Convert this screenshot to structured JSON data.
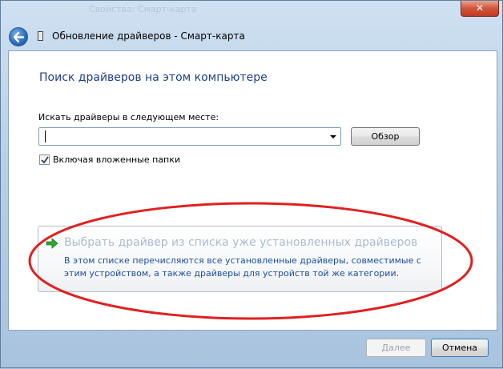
{
  "window": {
    "title": "Обновление драйверов - Смарт-карта",
    "close_label": "✕",
    "ghost_titles": "Свойства: Смарт-карта"
  },
  "page": {
    "heading": "Поиск драйверов на этом компьютере",
    "search_label": "Искать драйверы в следующем месте:",
    "path_value": "",
    "browse_label": "Обзор",
    "include_subfolders_label": "Включая вложенные папки",
    "include_subfolders_checked": true
  },
  "command_link": {
    "title": "Выбрать драйвер из списка уже установленных драйверов",
    "description": "В этом списке перечисляются все установленные драйверы, совместимые с этим устройством, а также драйверы для устройств той же категории."
  },
  "footer": {
    "next_label": "Далее",
    "cancel_label": "Отмена"
  },
  "colors": {
    "heading": "#1e3f8a",
    "link_text": "#1c4fa0",
    "highlight_ellipse": "#e02020",
    "arrow_green": "#2fa52f"
  },
  "icons": [
    "back-arrow-icon",
    "device-icon",
    "checkmark-icon",
    "green-arrow-icon",
    "close-icon",
    "dropdown-arrow-icon"
  ]
}
